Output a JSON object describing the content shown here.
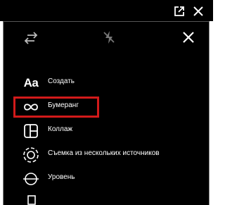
{
  "colors": {
    "background": "#000000",
    "text": "#ffffff",
    "highlight": "#d21a1a"
  },
  "top_bar": {
    "open_external_icon": "open-in-new-icon",
    "close_icon": "close-icon"
  },
  "camera_controls": {
    "switch_icon": "switch-camera-icon",
    "flash_icon": "flash-off-icon",
    "close_icon": "close-icon"
  },
  "menu": {
    "items": [
      {
        "icon": "text-aa-icon",
        "icon_text": "Aa",
        "label": "Создать"
      },
      {
        "icon": "infinity-icon",
        "label": "Бумеранг",
        "highlighted": true
      },
      {
        "icon": "layout-icon",
        "label": "Коллаж"
      },
      {
        "icon": "multi-capture-icon",
        "label": "Съемка из нескольких источников"
      },
      {
        "icon": "level-icon",
        "label": "Уровень"
      }
    ]
  }
}
